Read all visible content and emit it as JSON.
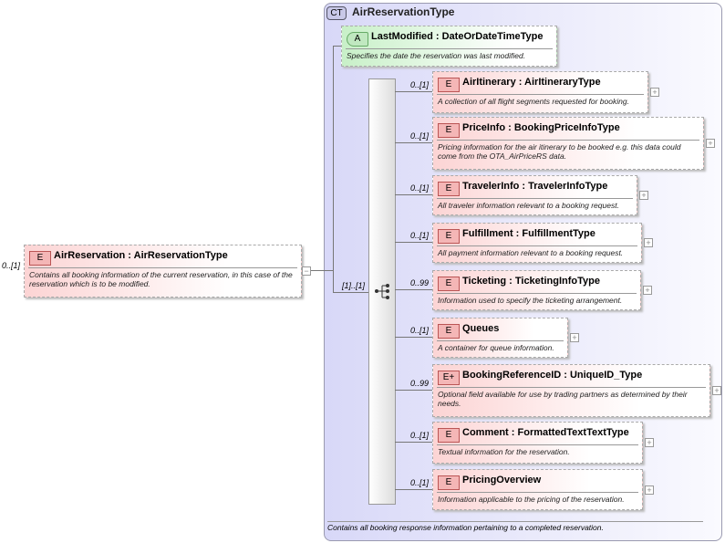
{
  "root": {
    "multiplicity": "0..[1]",
    "badge": "E",
    "title": "AirReservation : AirReservationType",
    "description": "Contains all booking information of the current reservation, in this case of the reservation which is to be modified.",
    "toggle": "−"
  },
  "complex_type": {
    "badge": "CT",
    "title": "AirReservationType",
    "footer": "Contains all booking response information pertaining to a completed reservation."
  },
  "attribute": {
    "badge": "A",
    "title": "LastModified : DateOrDateTimeType",
    "description": "Specifies the date the reservation was last modified."
  },
  "sequence": {
    "multiplicity": "[1]..[1]"
  },
  "elements": [
    {
      "multiplicity": "0..[1]",
      "badge": "E",
      "title": "AirItinerary : AirItineraryType",
      "description": "A collection of all flight segments requested for booking."
    },
    {
      "multiplicity": "0..[1]",
      "badge": "E",
      "title": "PriceInfo : BookingPriceInfoType",
      "description": "Pricing information for the air itinerary to be booked e.g. this data could come from the OTA_AirPriceRS data."
    },
    {
      "multiplicity": "0..[1]",
      "badge": "E",
      "title": "TravelerInfo : TravelerInfoType",
      "description": "All traveler information relevant to a booking request."
    },
    {
      "multiplicity": "0..[1]",
      "badge": "E",
      "title": "Fulfillment : FulfillmentType",
      "description": "All payment information relevant to a booking request."
    },
    {
      "multiplicity": "0..99",
      "badge": "E",
      "title": "Ticketing : TicketingInfoType",
      "description": "Information used to specify the ticketing arrangement."
    },
    {
      "multiplicity": "0..[1]",
      "badge": "E",
      "title": "Queues",
      "description": "A container for queue information."
    },
    {
      "multiplicity": "0..99",
      "badge": "E+",
      "title": "BookingReferenceID : UniqueID_Type",
      "description": "Optional field available for use by trading partners as determined by their needs."
    },
    {
      "multiplicity": "0..[1]",
      "badge": "E",
      "title": "Comment : FormattedTextTextType",
      "description": "Textual information for the reservation."
    },
    {
      "multiplicity": "0..[1]",
      "badge": "E",
      "title": "PricingOverview",
      "description": "Information applicable to the pricing of the reservation."
    }
  ],
  "expand_toggle": "+"
}
